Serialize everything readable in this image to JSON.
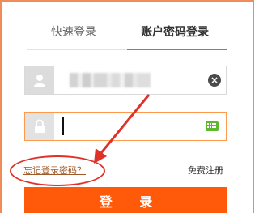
{
  "tabs": {
    "quick_login": "快速登录",
    "account_login": "账户密码登录"
  },
  "username": {
    "value": "",
    "clear_icon": "×"
  },
  "password": {
    "value": ""
  },
  "links": {
    "forgot_password": "忘记登录密码？",
    "register": "免费注册"
  },
  "login_button": "登 录",
  "icons": {
    "user": "user-icon",
    "lock": "lock-icon",
    "clear": "clear-icon",
    "keyboard": "keyboard-icon"
  },
  "colors": {
    "accent": "#ff5a00",
    "annotation": "#e0302a",
    "keyboard": "#5db92c"
  }
}
